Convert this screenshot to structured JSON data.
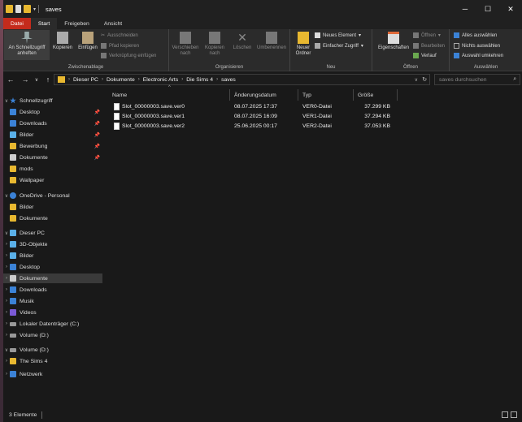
{
  "window": {
    "title": "saves",
    "minimize_glyph": "─",
    "maximize_glyph": "☐",
    "close_glyph": "✕"
  },
  "menu": {
    "file": "Datei",
    "start": "Start",
    "share": "Freigeben",
    "view": "Ansicht"
  },
  "ribbon": {
    "clipboard": {
      "label": "Zwischenablage",
      "pin": "An Schnellzugriff anheften",
      "copy": "Kopieren",
      "paste": "Einfügen",
      "cut": "Ausschneiden",
      "copy_path": "Pfad kopieren",
      "paste_shortcut": "Verknüpfung einfügen"
    },
    "organize": {
      "label": "Organisieren",
      "move": "Verschieben nach",
      "copyto": "Kopieren nach",
      "delete": "Löschen",
      "rename": "Umbenennen"
    },
    "new": {
      "label": "Neu",
      "new_folder": "Neuer Ordner",
      "new_item": "Neues Element",
      "easy_access": "Einfacher Zugriff"
    },
    "open": {
      "label": "Öffnen",
      "properties": "Eigenschaften",
      "open": "Öffnen",
      "edit": "Bearbeiten",
      "history": "Verlauf"
    },
    "select": {
      "label": "Auswählen",
      "select_all": "Alles auswählen",
      "select_none": "Nichts auswählen",
      "invert": "Auswahl umkehren"
    }
  },
  "address": {
    "segments": [
      "Dieser PC",
      "Dokumente",
      "Electronic Arts",
      "Die Sims 4",
      "saves"
    ],
    "search_placeholder": "saves durchsuchen"
  },
  "sidebar": {
    "quick_access": "Schnellzugriff",
    "quick_items": [
      "Desktop",
      "Downloads",
      "Bilder",
      "Bewerbung",
      "Dokumente",
      "mods",
      "Wallpaper"
    ],
    "onedrive": "OneDrive - Personal",
    "onedrive_items": [
      "Bilder",
      "Dokumente"
    ],
    "this_pc": "Dieser PC",
    "pc_items": [
      "3D-Objekte",
      "Bilder",
      "Desktop",
      "Dokumente",
      "Downloads",
      "Musik",
      "Videos",
      "Lokaler Datenträger (C:)",
      "Volume (D:)"
    ],
    "volume": "Volume (D:)",
    "volume_items": [
      "The Sims 4"
    ],
    "network": "Netzwerk"
  },
  "columns": {
    "name": "Name",
    "modified": "Änderungsdatum",
    "type": "Typ",
    "size": "Größe"
  },
  "files": [
    {
      "name": "Slot_00000003.save.ver0",
      "modified": "08.07.2025 17:37",
      "type": "VER0-Datei",
      "size": "37.299 KB"
    },
    {
      "name": "Slot_00000003.save.ver1",
      "modified": "08.07.2025 16:09",
      "type": "VER1-Datei",
      "size": "37.294 KB"
    },
    {
      "name": "Slot_00000003.save.ver2",
      "modified": "25.06.2025 00:17",
      "type": "VER2-Datei",
      "size": "37.053 KB"
    }
  ],
  "status": {
    "count": "3 Elemente"
  },
  "colors": {
    "folder": "#e8b830",
    "accent": "#c42b1c",
    "blue": "#3b82d6"
  }
}
